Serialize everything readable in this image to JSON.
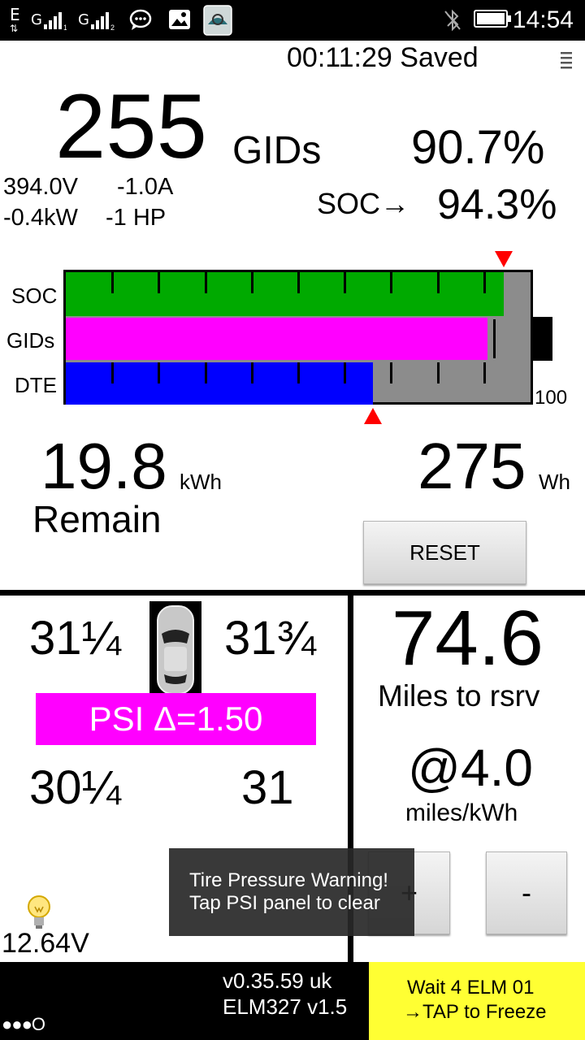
{
  "status_bar": {
    "net_type": "E",
    "sim1": "G",
    "sim2": "G",
    "time": "14:54",
    "icons": [
      "data-arrows-icon",
      "signal-sim1-icon",
      "signal-sim2-icon",
      "chat-icon",
      "image-icon",
      "app-icon",
      "bluetooth-off-icon",
      "battery-icon"
    ]
  },
  "header": {
    "elapsed": "00:11:29",
    "saved": "Saved",
    "menu_icon": "menu-icon"
  },
  "energy": {
    "gids_value": "255",
    "gids_unit": "GIDs",
    "gids_percent": "90.7%",
    "voltage": "394.0V",
    "current": "-1.0A",
    "power_kw": "-0.4kW",
    "power_hp": "-1 HP",
    "soc_label": "SOC→",
    "soc_percent": "94.3%"
  },
  "bar_chart": {
    "labels": [
      "SOC",
      "GIDs",
      "DTE"
    ],
    "scale_max_label": "100",
    "soc_fill": 0.943,
    "gids_fill": 0.907,
    "dte_fill": 0.66,
    "colors": {
      "soc": "#00aa00",
      "gids": "#ff00ff",
      "dte": "#0000ff",
      "background": "#8c8c8c",
      "marker": "#ff0000"
    }
  },
  "remaining": {
    "kwh_value": "19.8",
    "kwh_unit": "kWh",
    "remain_label": "Remain",
    "wh_value": "275",
    "wh_unit": "Wh",
    "reset_label": "RESET"
  },
  "tires": {
    "front_left": "31¼",
    "front_right": "31¾",
    "rear_left": "30¼",
    "rear_right": "31",
    "psi_banner": "PSI  Δ=1.50",
    "car_icon": "car-top-view-icon"
  },
  "range": {
    "miles_value": "74.6",
    "miles_label": "Miles to rsrv",
    "efficiency_value": "@4.0",
    "efficiency_unit": "miles/kWh",
    "plus_label": "+",
    "minus_label": "-"
  },
  "toast": {
    "line1": "Tire Pressure Warning!",
    "line2": "Tap PSI panel to clear"
  },
  "aux": {
    "battery_voltage": "12.64V",
    "bulb_icon": "light-bulb-icon"
  },
  "footer": {
    "dots": "●●●O",
    "version": "v0.35.59 uk",
    "adapter": "ELM327 v1.5",
    "wait_line": "Wait 4 ELM  01",
    "tap_line": "→TAP to Freeze"
  }
}
